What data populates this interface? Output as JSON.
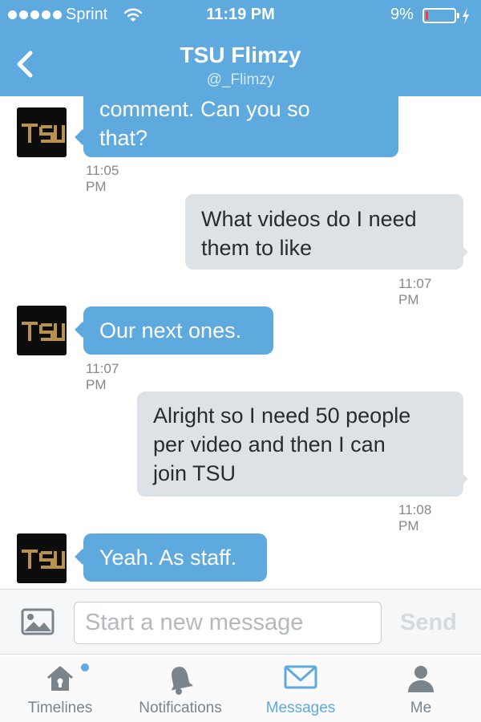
{
  "status_bar": {
    "carrier": "Sprint",
    "time": "11:19 PM",
    "battery": "9%",
    "battery_level": 0.09,
    "signal_bars": 5
  },
  "header": {
    "title": "TSU Flimzy",
    "handle": "@_Flimzy",
    "back_icon": "chevron-left-icon"
  },
  "messages": [
    {
      "direction": "in",
      "lines": [
        "comment. Can you so",
        "that?"
      ],
      "time": "11:05 PM"
    },
    {
      "direction": "out",
      "lines": [
        "What videos do I need",
        "them to like"
      ],
      "time": "11:07 PM"
    },
    {
      "direction": "in",
      "lines": [
        "Our next ones."
      ],
      "time": "11:07 PM"
    },
    {
      "direction": "out",
      "lines": [
        "Alright so I need 50 people",
        "per video and then I can",
        "join TSU"
      ],
      "time": "11:08 PM"
    },
    {
      "direction": "in",
      "lines": [
        "Yeah. As staff."
      ],
      "time": ""
    }
  ],
  "composer": {
    "placeholder": "Start a new message",
    "value": "",
    "send_label": "Send",
    "photo_icon": "image-icon"
  },
  "tabs": [
    {
      "label": "Timelines",
      "icon": "home-icon",
      "active": false,
      "has_notification": true
    },
    {
      "label": "Notifications",
      "icon": "bell-icon",
      "active": false
    },
    {
      "label": "Messages",
      "icon": "envelope-icon",
      "active": true
    },
    {
      "label": "Me",
      "icon": "person-icon",
      "active": false
    }
  ],
  "colors": {
    "brand": "#5ea9dd",
    "incoming_bubble": "#5ea9dd",
    "outgoing_bubble": "#dde2e6",
    "battery_low": "#ff3b30"
  }
}
